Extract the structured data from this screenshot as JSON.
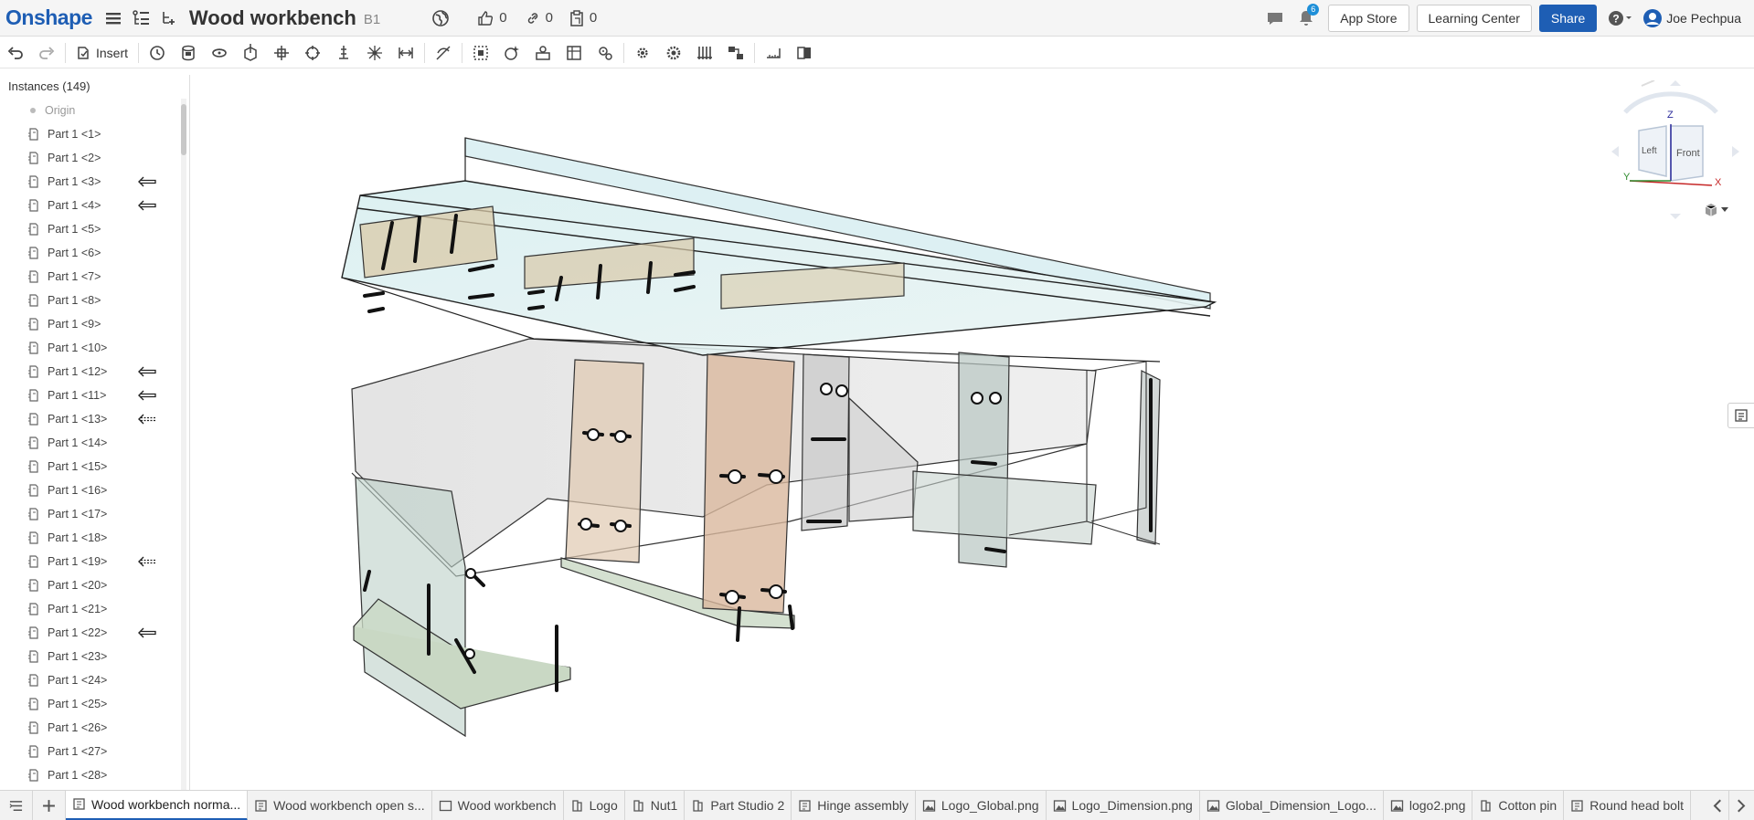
{
  "header": {
    "logo": "Onshape",
    "doc_title": "Wood workbench",
    "workspace": "B1",
    "likes": "0",
    "links": "0",
    "copies": "0",
    "notifications": "6",
    "app_store": "App Store",
    "learning_center": "Learning Center",
    "share": "Share",
    "user": "Joe Pechpua"
  },
  "toolbar": {
    "insert": "Insert"
  },
  "instances": {
    "header": "Instances (149)",
    "origin": "Origin",
    "items": [
      {
        "label": "Part 1 <1>",
        "arrow": ""
      },
      {
        "label": "Part 1 <2>",
        "arrow": ""
      },
      {
        "label": "Part 1 <3>",
        "arrow": "solid"
      },
      {
        "label": "Part 1 <4>",
        "arrow": "solid"
      },
      {
        "label": "Part 1 <5>",
        "arrow": ""
      },
      {
        "label": "Part 1 <6>",
        "arrow": ""
      },
      {
        "label": "Part 1 <7>",
        "arrow": ""
      },
      {
        "label": "Part 1 <8>",
        "arrow": ""
      },
      {
        "label": "Part 1 <9>",
        "arrow": ""
      },
      {
        "label": "Part 1 <10>",
        "arrow": ""
      },
      {
        "label": "Part 1 <12>",
        "arrow": "solid"
      },
      {
        "label": "Part 1 <11>",
        "arrow": "solid"
      },
      {
        "label": "Part 1 <13>",
        "arrow": "dashed"
      },
      {
        "label": "Part 1 <14>",
        "arrow": ""
      },
      {
        "label": "Part 1 <15>",
        "arrow": ""
      },
      {
        "label": "Part 1 <16>",
        "arrow": ""
      },
      {
        "label": "Part 1 <17>",
        "arrow": ""
      },
      {
        "label": "Part 1 <18>",
        "arrow": ""
      },
      {
        "label": "Part 1 <19>",
        "arrow": "dashed"
      },
      {
        "label": "Part 1 <20>",
        "arrow": ""
      },
      {
        "label": "Part 1 <21>",
        "arrow": ""
      },
      {
        "label": "Part 1 <22>",
        "arrow": "solid"
      },
      {
        "label": "Part 1 <23>",
        "arrow": ""
      },
      {
        "label": "Part 1 <24>",
        "arrow": ""
      },
      {
        "label": "Part 1 <25>",
        "arrow": ""
      },
      {
        "label": "Part 1 <26>",
        "arrow": ""
      },
      {
        "label": "Part 1 <27>",
        "arrow": ""
      },
      {
        "label": "Part 1 <28>",
        "arrow": ""
      }
    ]
  },
  "viewcube": {
    "top": "Z",
    "left_face": "Left",
    "front_face": "Front",
    "axis_x": "X",
    "axis_y": "Y"
  },
  "tabs": [
    {
      "label": "Wood workbench norma...",
      "icon": "assembly-icon",
      "active": true
    },
    {
      "label": "Wood workbench open s...",
      "icon": "assembly-icon",
      "active": false
    },
    {
      "label": "Wood workbench",
      "icon": "drawing-icon",
      "active": false
    },
    {
      "label": "Logo",
      "icon": "part-studio-icon",
      "active": false
    },
    {
      "label": "Nut1",
      "icon": "part-studio-icon",
      "active": false
    },
    {
      "label": "Part Studio 2",
      "icon": "part-studio-icon",
      "active": false
    },
    {
      "label": "Hinge assembly",
      "icon": "assembly-icon",
      "active": false
    },
    {
      "label": "Logo_Global.png",
      "icon": "image-icon",
      "active": false
    },
    {
      "label": "Logo_Dimension.png",
      "icon": "image-icon",
      "active": false
    },
    {
      "label": "Global_Dimension_Logo...",
      "icon": "image-icon",
      "active": false
    },
    {
      "label": "logo2.png",
      "icon": "image-icon",
      "active": false
    },
    {
      "label": "Cotton pin",
      "icon": "part-studio-icon",
      "active": false
    },
    {
      "label": "Round head bolt",
      "icon": "assembly-icon",
      "active": false
    }
  ],
  "colors": {
    "brand": "#1e5eb4"
  }
}
